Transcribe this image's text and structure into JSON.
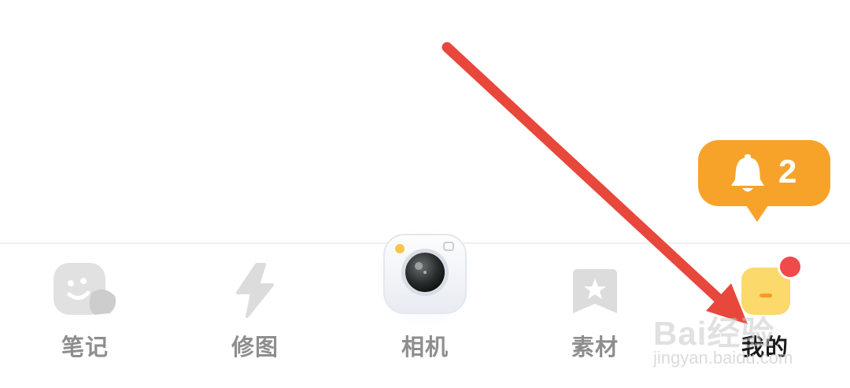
{
  "tabs": [
    {
      "label": "笔记",
      "icon": "sticker-face-icon",
      "active": false
    },
    {
      "label": "修图",
      "icon": "lightning-icon",
      "active": false
    },
    {
      "label": "相机",
      "icon": "camera-icon",
      "active": false
    },
    {
      "label": "素材",
      "icon": "star-bookmark-icon",
      "active": false
    },
    {
      "label": "我的",
      "icon": "profile-icon",
      "active": true
    }
  ],
  "notification": {
    "icon": "bell-icon",
    "count": "2"
  },
  "watermark": {
    "main": "Bai经验",
    "sub": "jingyan.baidu.com"
  },
  "colors": {
    "accent_orange": "#f7a32a",
    "badge_red": "#f04a4a",
    "arrow_red": "#e8473b",
    "label_gray": "#8e8e8e",
    "label_active": "#1a1a1a"
  }
}
